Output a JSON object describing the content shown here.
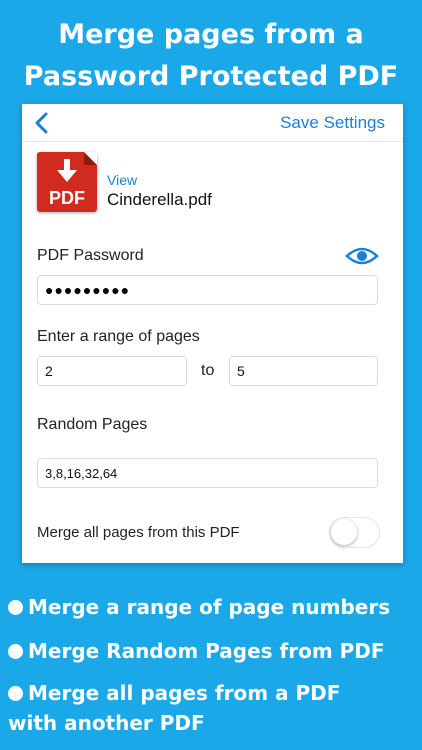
{
  "headline": {
    "line1": "Merge pages from a",
    "line2": "Password Protected PDF"
  },
  "navbar": {
    "back_icon": "chevron-left-icon",
    "save_label": "Save Settings"
  },
  "file": {
    "icon": "pdf-file-icon",
    "icon_text": "PDF",
    "view_label": "View",
    "name": "Cinderella.pdf"
  },
  "password": {
    "label": "PDF Password",
    "value": "●●●●●●●●●",
    "reveal_icon": "eye-icon"
  },
  "range": {
    "label": "Enter a range of pages",
    "from": "2",
    "to_label": "to",
    "to": "5"
  },
  "random": {
    "label": "Random Pages",
    "value": "3,8,16,32,64"
  },
  "merge_all": {
    "label": "Merge all pages from this PDF",
    "enabled": false
  },
  "features": [
    {
      "line1": "Merge a range of page numbers"
    },
    {
      "line1": "Merge Random Pages from PDF"
    },
    {
      "line1": "Merge all pages from a PDF",
      "line2": "with another PDF"
    }
  ],
  "colors": {
    "background": "#1ba8e8",
    "accent": "#1a80d8",
    "pdf_red": "#d12b1f"
  }
}
